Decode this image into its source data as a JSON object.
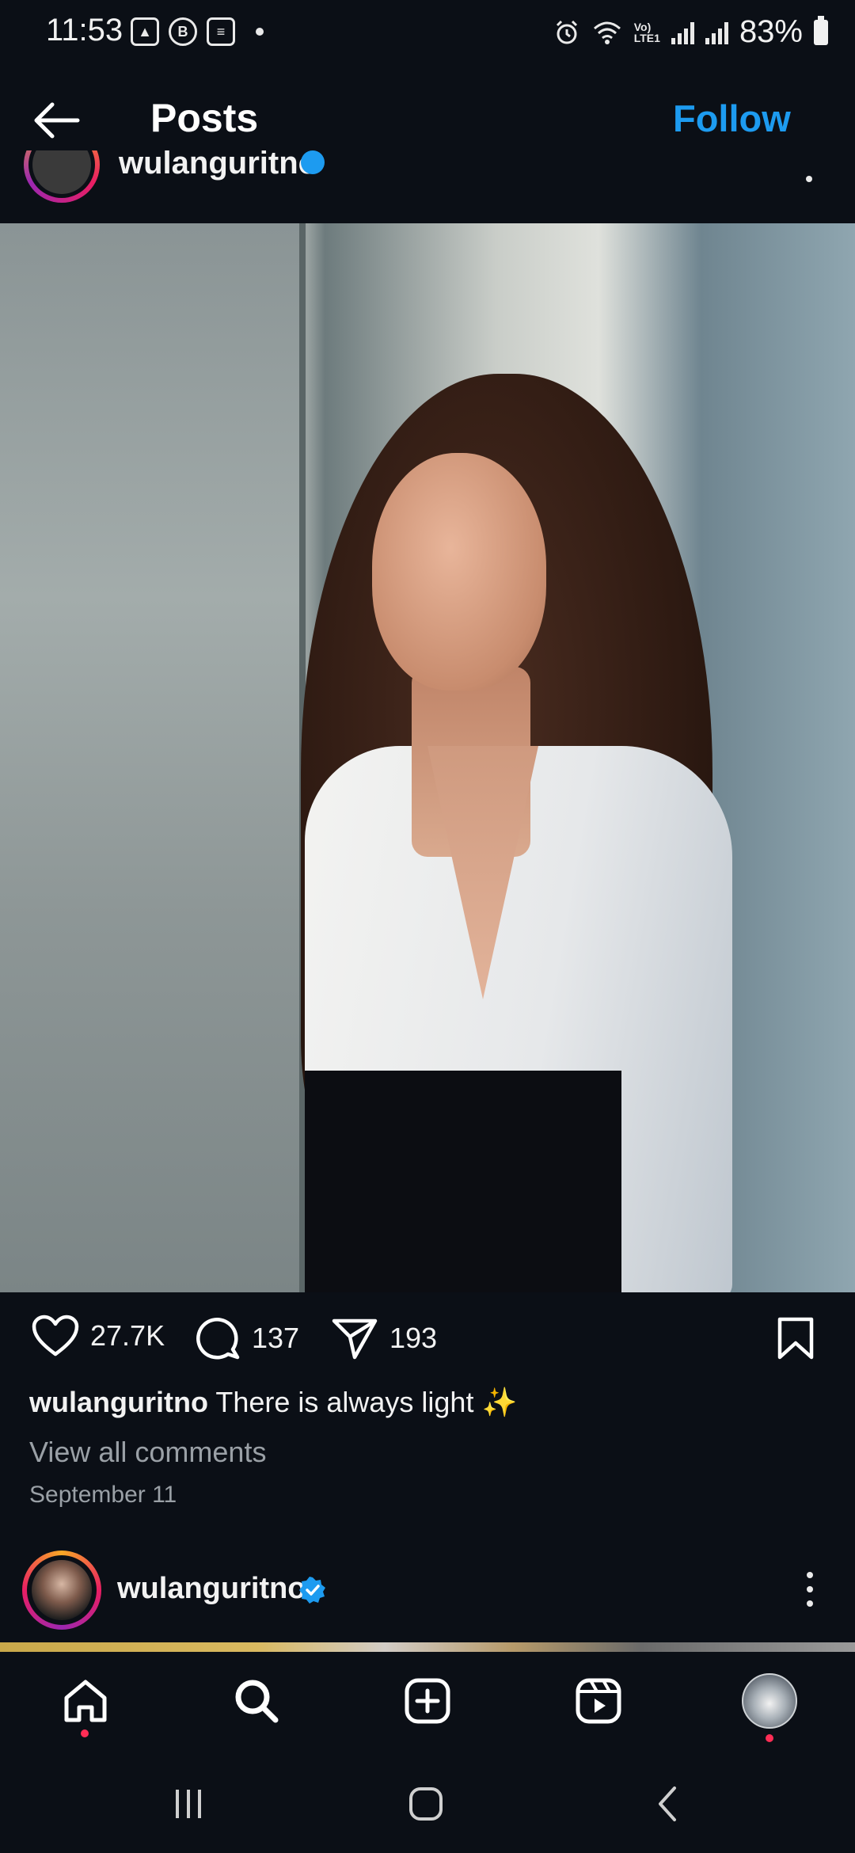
{
  "status_bar": {
    "time": "11:53",
    "battery": "83%",
    "network": "LTE1"
  },
  "header": {
    "title": "Posts",
    "follow_label": "Follow"
  },
  "post": {
    "username": "wulanguritno",
    "verified": true,
    "likes": "27.7K",
    "comments": "137",
    "shares": "193",
    "caption_user": "wulanguritno",
    "caption_text": "There is always light ✨",
    "view_comments": "View all comments",
    "date": "September 11"
  },
  "next_post": {
    "username": "wulanguritno",
    "verified": true
  },
  "bottom_nav": {
    "items": [
      "home",
      "search",
      "create",
      "reels",
      "profile"
    ]
  },
  "colors": {
    "background": "#0b0f16",
    "accent": "#1d9bf0",
    "notification": "#ff2d55"
  }
}
